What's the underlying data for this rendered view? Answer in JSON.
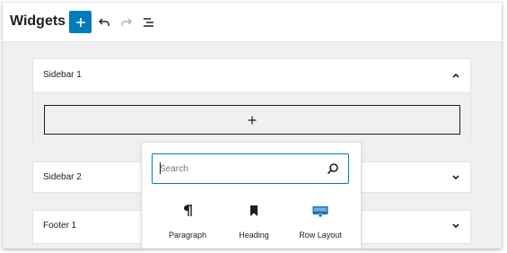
{
  "header": {
    "title": "Widgets",
    "add_icon": "plus-icon",
    "undo_icon": "undo-icon",
    "redo_icon": "redo-icon",
    "outline_icon": "list-view-icon"
  },
  "areas": [
    {
      "title": "Sidebar 1",
      "expanded": true
    },
    {
      "title": "Sidebar 2",
      "expanded": false
    },
    {
      "title": "Footer 1",
      "expanded": false
    }
  ],
  "inserter": {
    "search_placeholder": "Search",
    "blocks": [
      {
        "label": "Paragraph",
        "icon": "paragraph-icon"
      },
      {
        "label": "Heading",
        "icon": "bookmark-icon"
      },
      {
        "label": "Row Layout",
        "icon": "row-layout-icon"
      }
    ]
  },
  "colors": {
    "accent": "#007cba",
    "text": "#1e1e1e",
    "canvas": "#f0f0f1"
  }
}
